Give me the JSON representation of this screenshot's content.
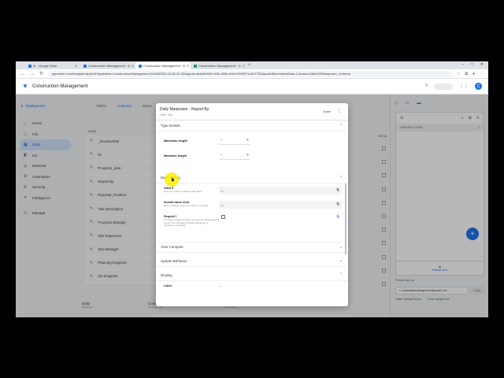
{
  "browser": {
    "tabs": [
      {
        "label": "M · Google Drive",
        "color": "#1a73e8",
        "active": false
      },
      {
        "label": "Construction Management · A",
        "color": "#1a73e8",
        "active": false
      },
      {
        "label": "Construction Management · A",
        "color": "#1a73e8",
        "active": true
      },
      {
        "label": "Construction Management · G",
        "color": "#0f9d58",
        "active": false
      }
    ],
    "url": "appsheet.com/template/AppDef?appName=ConstructionManagement-024940525-24-05-30-30&appId=ab0a9e949-0d1b-4b8e-b3e0-9099571a007760&quickStart=false#Data.Columns.Daily%20Manpower_Schema"
  },
  "app": {
    "name": "Construction Management",
    "avatar_letter": "C"
  },
  "nav": {
    "deployment": "Deployment",
    "items": [
      {
        "label": "Home",
        "icon": "⌂",
        "active": false
      },
      {
        "label": "Info",
        "icon": "ⓘ",
        "active": false
      },
      {
        "label": "Data",
        "icon": "▦",
        "active": true
      },
      {
        "label": "UX",
        "icon": "◧",
        "active": false
      },
      {
        "label": "Behavior",
        "icon": "◎",
        "active": false
      },
      {
        "label": "Automation",
        "icon": "⚙",
        "active": false
      },
      {
        "label": "Security",
        "icon": "⛨",
        "active": false
      },
      {
        "label": "Intelligence",
        "icon": "✦",
        "active": false
      },
      {
        "label": "Manage",
        "icon": "☷",
        "active": false
      }
    ]
  },
  "background": {
    "tabs": [
      "Tables",
      "Columns",
      "Slices",
      "User"
    ],
    "name_header": "NAME",
    "initial_header": "INITIAL",
    "columns": [
      "_RowNumber",
      "ID",
      "Progress_date",
      "Report By",
      "Reporter_Position",
      "Title Description",
      "Progress Manage",
      "Site Supervisor",
      "Site Manager",
      "Planning Engineer",
      "QS Engineer"
    ],
    "bottom_tables": [
      {
        "name": "Daily",
        "sub": "Manpower"
      },
      {
        "name": "Contract_List",
        "sub": "Contract_List"
      },
      {
        "name": "User_Name",
        "sub": "User_Name"
      }
    ]
  },
  "preview": {
    "group_label": "GROUND FLOOR",
    "group_count": "1",
    "bottom_tab": "Default view",
    "preview_as_label": "Preview app as",
    "email": "contactstarmanagement@gmail.com",
    "apply": "Apply",
    "links": [
      "Table: Default Report",
      "Form: Default List"
    ]
  },
  "dialog": {
    "title": "Daily Manpower : Report By:",
    "subtitle": "Field · Text",
    "done": "Done",
    "type_details": "Type Details",
    "maximum_length": "Maximum length",
    "minimum_length": "Minimum length",
    "data_validity": "Data Validity",
    "valid_if": {
      "label": "Valid If",
      "help": "Does the column contain valid data?"
    },
    "invalid_error": {
      "label": "Invalid value error",
      "help": "Error message when the value is not valid"
    },
    "require": {
      "label": "Require?",
      "help": "Are users required to fill in this column before saving a row? You can also provide a Required_If expression to decide."
    },
    "auto_compute": "Auto Compute",
    "update_behavior": "Update Behavior",
    "display": "Display",
    "label_field": "Label",
    "equals": "="
  }
}
